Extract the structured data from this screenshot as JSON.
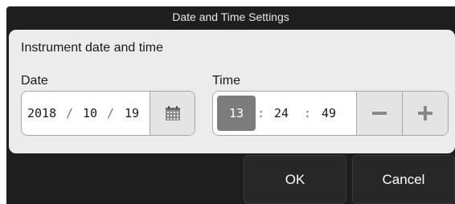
{
  "dialog": {
    "title": "Date and Time Settings"
  },
  "section": {
    "title": "Instrument date and time"
  },
  "date": {
    "label": "Date",
    "year": "2018",
    "month": "10",
    "day": "19",
    "separator": "/",
    "calendar_icon": "calendar-icon"
  },
  "time": {
    "label": "Time",
    "hour": "13",
    "minute": "24",
    "second": "49",
    "separator": ":",
    "decrement_icon": "minus-icon",
    "increment_icon": "plus-icon"
  },
  "buttons": {
    "ok": "OK",
    "cancel": "Cancel"
  },
  "colors": {
    "dialog_background": "#1e1e1e",
    "panel_background": "#ececec",
    "selected_segment": "#7c7c7c",
    "stepper_icon": "#888888"
  }
}
